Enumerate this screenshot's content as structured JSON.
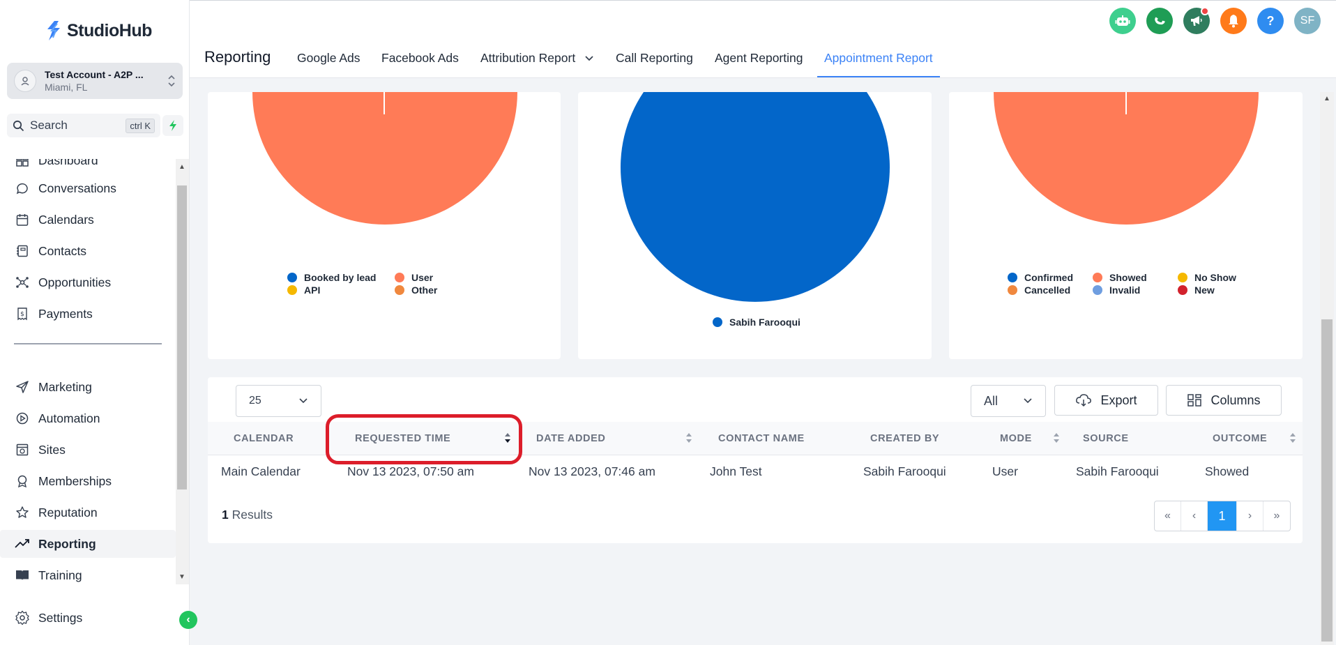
{
  "app": {
    "name": "StudioHub"
  },
  "account": {
    "name": "Test Account - A2P ...",
    "location": "Miami, FL"
  },
  "search": {
    "label": "Search",
    "shortcut": "ctrl K"
  },
  "sidebar": {
    "items": [
      {
        "label": "Dashboard",
        "icon": "dashboard-icon"
      },
      {
        "label": "Conversations",
        "icon": "chat-icon"
      },
      {
        "label": "Calendars",
        "icon": "calendar-icon"
      },
      {
        "label": "Contacts",
        "icon": "contacts-icon"
      },
      {
        "label": "Opportunities",
        "icon": "opportunities-icon"
      },
      {
        "label": "Payments",
        "icon": "payments-icon"
      },
      {
        "label": "Marketing",
        "icon": "send-icon"
      },
      {
        "label": "Automation",
        "icon": "automation-icon"
      },
      {
        "label": "Sites",
        "icon": "sites-icon"
      },
      {
        "label": "Memberships",
        "icon": "badge-icon"
      },
      {
        "label": "Reputation",
        "icon": "star-icon"
      },
      {
        "label": "Reporting",
        "icon": "trending-icon",
        "active": true
      },
      {
        "label": "Training",
        "icon": "book-icon"
      }
    ],
    "settings": "Settings"
  },
  "header": {
    "title": "Reporting",
    "tabs": [
      {
        "label": "Google Ads"
      },
      {
        "label": "Facebook Ads"
      },
      {
        "label": "Attribution Report"
      },
      {
        "label": "Call Reporting"
      },
      {
        "label": "Agent Reporting"
      },
      {
        "label": "Appointment Report",
        "active": true
      }
    ],
    "avatar_initials": "SF",
    "help": "?"
  },
  "colors": {
    "brand": "#3b82f6",
    "booked_blue": "#0366c9",
    "user_orange": "#ff7b57",
    "api_yellow": "#f5b800",
    "other_orange": "#f0883e",
    "invalid_blue": "#6f9ee0",
    "new_red": "#d2222d",
    "highlight_red": "#dc1d2a"
  },
  "charts": {
    "source": {
      "legend": [
        "Booked by lead",
        "User",
        "API",
        "Other"
      ]
    },
    "created_by": {
      "legend": [
        "Sabih Farooqui"
      ]
    },
    "status": {
      "legend": [
        "Confirmed",
        "Showed",
        "No Show",
        "Cancelled",
        "Invalid",
        "New"
      ]
    }
  },
  "table": {
    "page_size": "25",
    "filter": "All",
    "export_label": "Export",
    "columns_label": "Columns",
    "headers": [
      "CALENDAR",
      "REQUESTED TIME",
      "DATE ADDED",
      "CONTACT NAME",
      "CREATED BY",
      "MODE",
      "SOURCE",
      "OUTCOME"
    ],
    "rows": [
      [
        "Main Calendar",
        "Nov 13 2023, 07:50 am",
        "Nov 13 2023, 07:46 am",
        "John Test",
        "Sabih Farooqui",
        "User",
        "Sabih Farooqui",
        "Showed"
      ]
    ],
    "results_count": "1",
    "results_label": "Results",
    "pagination": {
      "first": "«",
      "prev": "‹",
      "current": "1",
      "next": "›",
      "last": "»"
    }
  }
}
